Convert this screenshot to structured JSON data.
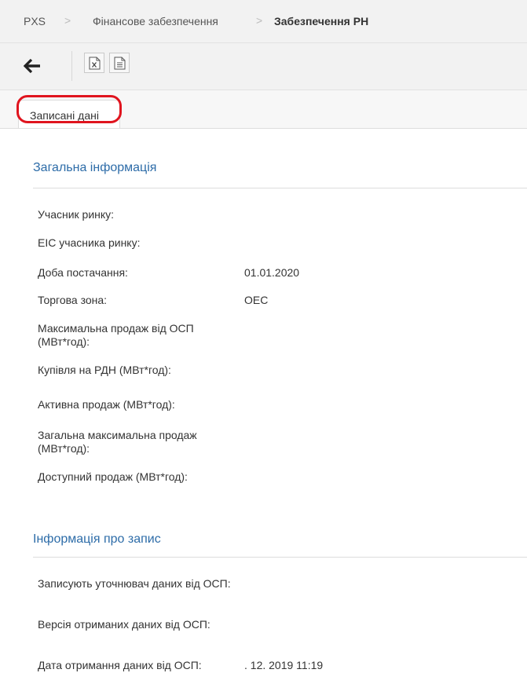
{
  "breadcrumb": {
    "items": [
      "PXS",
      "Фінансове забезпечення",
      "Забезпечення РН"
    ],
    "separator": ">"
  },
  "toolbar": {
    "back_icon": "arrow-left-icon",
    "buttons": [
      {
        "name": "export-excel-button",
        "icon": "excel-file-icon"
      },
      {
        "name": "export-document-button",
        "icon": "document-icon"
      }
    ]
  },
  "tabs": [
    {
      "label": "Записані дані",
      "active": true,
      "highlighted": true
    }
  ],
  "colors": {
    "accent": "#2d6ca8",
    "highlight": "#e0141e",
    "bar_background": "#f2f2f2"
  },
  "general": {
    "title": "Загальна інформація",
    "fields": [
      {
        "label": "Учасник ринку:",
        "value": ""
      },
      {
        "label": "EIC учасника ринку:",
        "value": ""
      },
      {
        "label": "Доба постачання:",
        "value": "01.01.2020"
      },
      {
        "label": "Торгова зона:",
        "value": "OEC"
      },
      {
        "label": "Максимальна продаж від ОСП (МВт*год):",
        "value": ""
      },
      {
        "label": "Купівля на РДН (МВт*год):",
        "value": ""
      },
      {
        "label": "Активна продаж (МВт*год):",
        "value": ""
      },
      {
        "label": "Загальна максимальна продаж (МВт*год):",
        "value": ""
      },
      {
        "label": "Доступний продаж (МВт*год):",
        "value": ""
      }
    ]
  },
  "record": {
    "title": "Інформація про запис",
    "fields": [
      {
        "label": "Записують уточнювач даних від ОСП:",
        "value": ""
      },
      {
        "label": "Версія отриманих даних від ОСП:",
        "value": ""
      },
      {
        "label": "Дата отримання даних від ОСП:",
        "value": ". 12. 2019 11:19"
      }
    ]
  }
}
